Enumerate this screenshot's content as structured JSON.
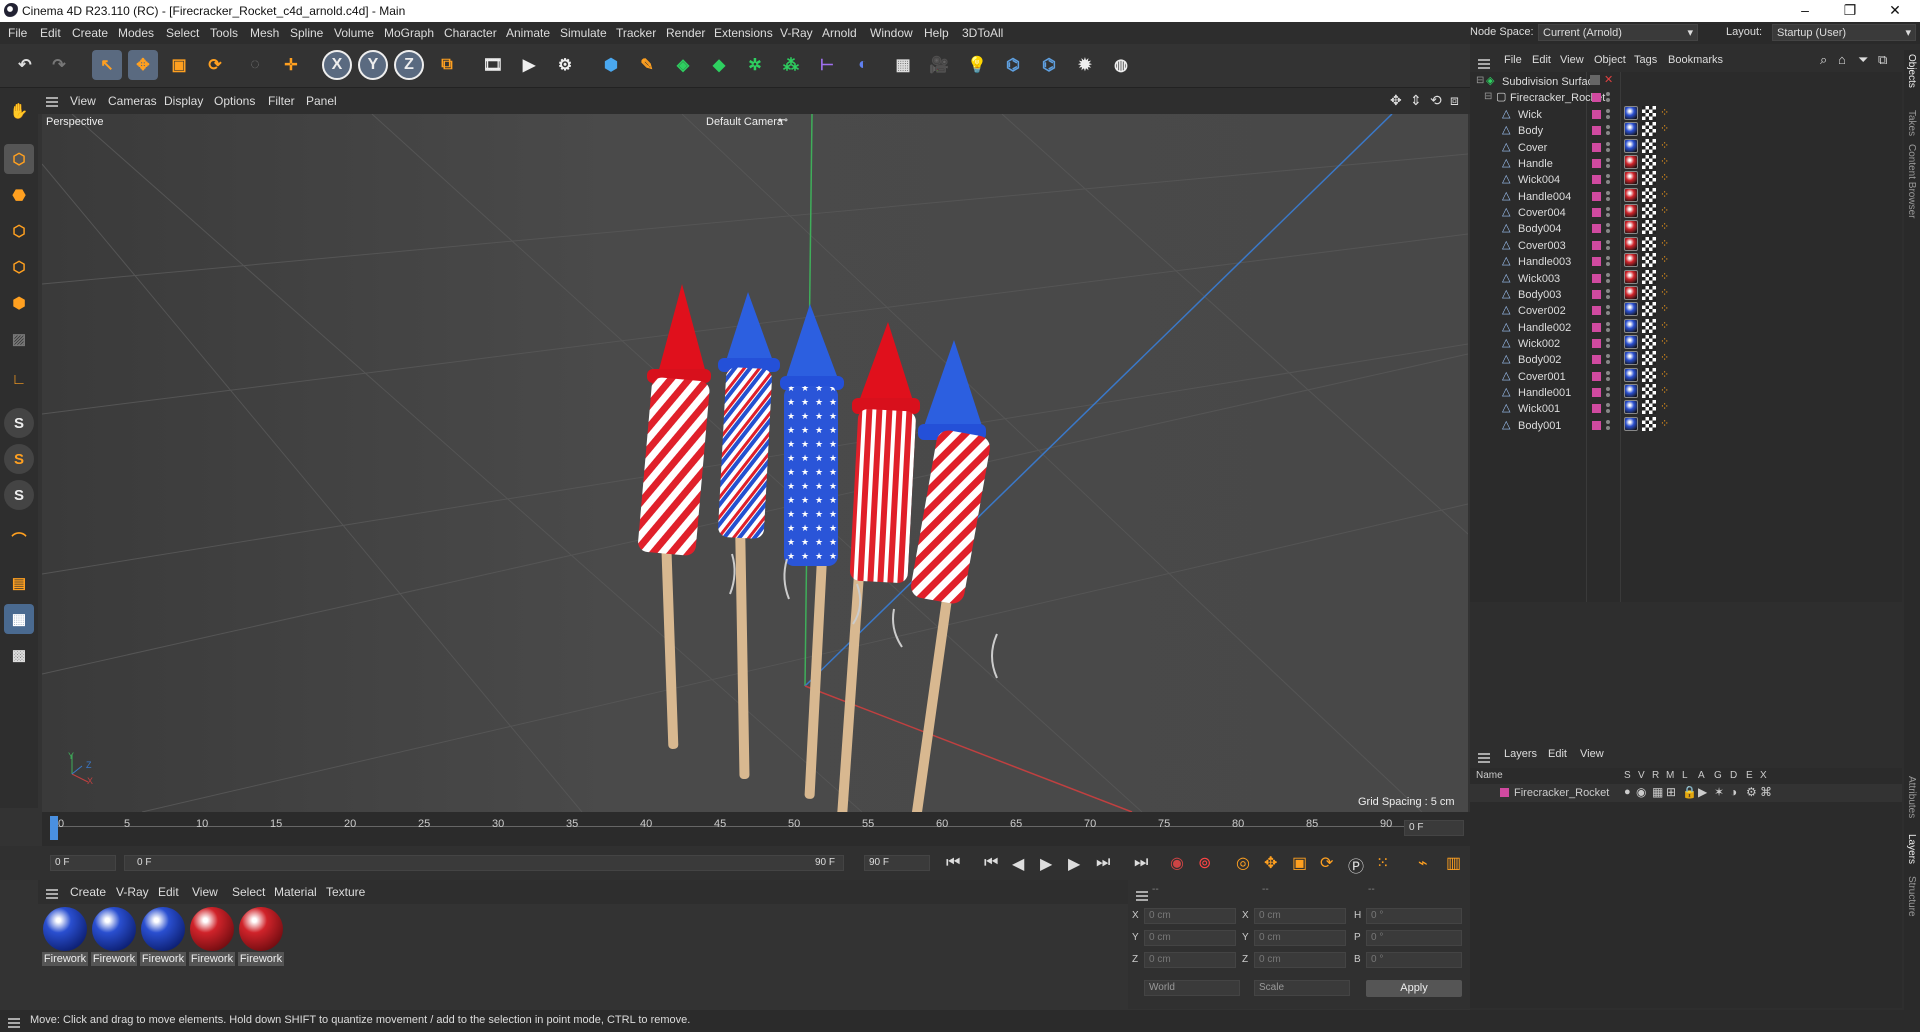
{
  "window": {
    "title": "Cinema 4D R23.110 (RC) - [Firecracker_Rocket_c4d_arnold.c4d] - Main",
    "minimize": "–",
    "maximize": "❐",
    "close": "✕"
  },
  "menubar": [
    "File",
    "Edit",
    "Create",
    "Modes",
    "Select",
    "Tools",
    "Mesh",
    "Spline",
    "Volume",
    "MoGraph",
    "Character",
    "Animate",
    "Simulate",
    "Tracker",
    "Render",
    "Extensions",
    "V-Ray",
    "Arnold",
    "Window",
    "Help",
    "3DToAll"
  ],
  "nodespace": {
    "label": "Node Space:",
    "value": "Current (Arnold)"
  },
  "layout": {
    "label": "Layout:",
    "value": "Startup (User)"
  },
  "toolbar": {
    "x_axis": "X",
    "y_axis": "Y",
    "z_axis": "Z"
  },
  "viewport_menu": [
    "View",
    "Cameras",
    "Display",
    "Options",
    "Filter",
    "Panel"
  ],
  "viewport": {
    "name": "Perspective",
    "camera": "Default Camera",
    "grid_spacing": "Grid Spacing : 5 cm",
    "axis_x": "X",
    "axis_y": "Y",
    "axis_z": "Z"
  },
  "timeline": {
    "ticks": [
      "0",
      "5",
      "10",
      "15",
      "20",
      "25",
      "30",
      "35",
      "40",
      "45",
      "50",
      "55",
      "60",
      "65",
      "70",
      "75",
      "80",
      "85",
      "90"
    ],
    "current_frame": "0 F"
  },
  "transport": {
    "start": "0 F",
    "range_start": "0 F",
    "range_end": "90 F",
    "end": "90 F"
  },
  "material_menu": [
    "Create",
    "V-Ray",
    "Edit",
    "View",
    "Select",
    "Material",
    "Texture"
  ],
  "materials": [
    {
      "name": "Firework",
      "color": "#2a4fd0"
    },
    {
      "name": "Firework",
      "color": "#2a4fd0"
    },
    {
      "name": "Firework",
      "color": "#2a4fd0"
    },
    {
      "name": "Firework",
      "color": "#d0232a"
    },
    {
      "name": "Firework",
      "color": "#d0232a"
    }
  ],
  "coords": {
    "head": [
      "--",
      "--",
      "--"
    ],
    "rows": [
      {
        "a": "X",
        "av": "0 cm",
        "b": "X",
        "bv": "0 cm",
        "c": "H",
        "cv": "0 °"
      },
      {
        "a": "Y",
        "av": "0 cm",
        "b": "Y",
        "bv": "0 cm",
        "c": "P",
        "cv": "0 °"
      },
      {
        "a": "Z",
        "av": "0 cm",
        "b": "Z",
        "bv": "0 cm",
        "c": "B",
        "cv": "0 °"
      }
    ],
    "mode1": "World",
    "mode2": "Scale",
    "apply": "Apply"
  },
  "status": "Move: Click and drag to move elements. Hold down SHIFT to quantize movement / add to the selection in point mode, CTRL to remove.",
  "objects_menu": [
    "File",
    "Edit",
    "View",
    "Object",
    "Tags",
    "Bookmarks"
  ],
  "objects": {
    "root": "Subdivision Surface",
    "group": "Firecracker_Rocket",
    "children": [
      {
        "name": "Wick",
        "tag": "blue"
      },
      {
        "name": "Body",
        "tag": "blue"
      },
      {
        "name": "Cover",
        "tag": "blue"
      },
      {
        "name": "Handle",
        "tag": "red"
      },
      {
        "name": "Wick004",
        "tag": "red"
      },
      {
        "name": "Handle004",
        "tag": "red"
      },
      {
        "name": "Cover004",
        "tag": "red"
      },
      {
        "name": "Body004",
        "tag": "red"
      },
      {
        "name": "Cover003",
        "tag": "red"
      },
      {
        "name": "Handle003",
        "tag": "red"
      },
      {
        "name": "Wick003",
        "tag": "red"
      },
      {
        "name": "Body003",
        "tag": "red"
      },
      {
        "name": "Cover002",
        "tag": "blue"
      },
      {
        "name": "Handle002",
        "tag": "blue"
      },
      {
        "name": "Wick002",
        "tag": "blue"
      },
      {
        "name": "Body002",
        "tag": "blue"
      },
      {
        "name": "Cover001",
        "tag": "blue"
      },
      {
        "name": "Handle001",
        "tag": "blue"
      },
      {
        "name": "Wick001",
        "tag": "blue"
      },
      {
        "name": "Body001",
        "tag": "blue"
      }
    ]
  },
  "side_tabs": [
    "Objects",
    "Takes",
    "Content Browser",
    "Attributes",
    "Layers",
    "Structure"
  ],
  "layers_menu": [
    "Layers",
    "Edit",
    "View"
  ],
  "layers_header": {
    "name": "Name",
    "cols": [
      "S",
      "V",
      "R",
      "M",
      "L",
      "A",
      "G",
      "D",
      "E",
      "X"
    ]
  },
  "layers": [
    {
      "name": "Firecracker_Rocket"
    }
  ]
}
